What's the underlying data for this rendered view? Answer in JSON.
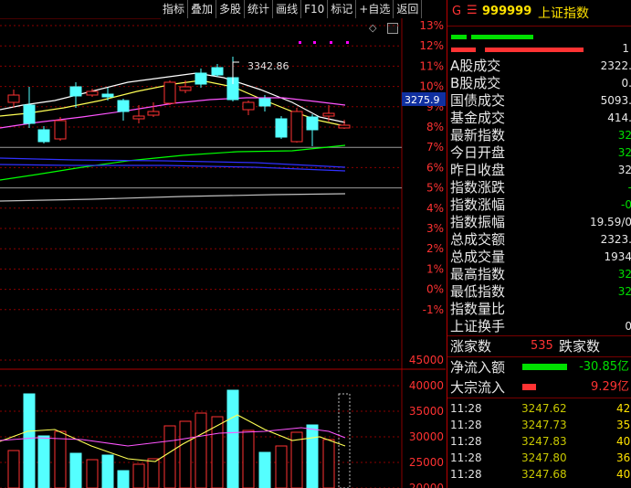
{
  "toolbar": {
    "buttons": [
      "指标",
      "叠加",
      "多股",
      "统计",
      "画线",
      "F10",
      "标记",
      "+自选",
      "返回"
    ]
  },
  "header": {
    "g_label": "G",
    "menu_icon_glyph": "☰",
    "code": "999999",
    "name": "上证指数"
  },
  "main_chart": {
    "price_scale_labels": [
      "13%",
      "12%",
      "11%",
      "10%",
      "9%",
      "8%",
      "7%",
      "6%",
      "5%",
      "4%",
      "3%",
      "2%",
      "1%",
      "0%",
      "-1%"
    ],
    "high_label": "3342.86",
    "current_price_tag": "3275.9"
  },
  "volume_chart": {
    "scale_labels": [
      "45000",
      "40000",
      "35000",
      "30000",
      "25000",
      "20000"
    ]
  },
  "quote": {
    "bar_value": "1",
    "rows": [
      {
        "label": "A股成交",
        "value": "2322.",
        "color": "#e8e8e8"
      },
      {
        "label": "B股成交",
        "value": "0.",
        "color": "#e8e8e8"
      },
      {
        "label": "国债成交",
        "value": "5093.",
        "color": "#e8e8e8"
      },
      {
        "label": "基金成交",
        "value": "414.",
        "color": "#e8e8e8"
      },
      {
        "label": "最新指数",
        "value": "32",
        "color": "#00e000"
      },
      {
        "label": "今日开盘",
        "value": "32",
        "color": "#00e000"
      },
      {
        "label": "昨日收盘",
        "value": "32",
        "color": "#e8e8e8"
      },
      {
        "label": "指数涨跌",
        "value": "-",
        "color": "#00e000"
      },
      {
        "label": "指数涨幅",
        "value": "-0",
        "color": "#00e000"
      },
      {
        "label": "指数振幅",
        "value": "19.59/0",
        "color": "#e8e8e8"
      },
      {
        "label": "总成交额",
        "value": "2323.",
        "color": "#e8e8e8"
      },
      {
        "label": "总成交量",
        "value": "1934",
        "color": "#e8e8e8"
      },
      {
        "label": "最高指数",
        "value": "32",
        "color": "#00e000"
      },
      {
        "label": "最低指数",
        "value": "32",
        "color": "#00e000"
      },
      {
        "label": "指数量比",
        "value": "",
        "color": "#e8e8e8"
      },
      {
        "label": "上证换手",
        "value": "0",
        "color": "#e8e8e8"
      }
    ]
  },
  "breadth": {
    "up_label": "涨家数",
    "up_value": "535",
    "down_label": "跌家数"
  },
  "flows": [
    {
      "label": "净流入额",
      "value": "-30.85亿",
      "color": "#00e000"
    },
    {
      "label": "大宗流入",
      "value": "9.29亿",
      "color": "#ff3333"
    }
  ],
  "ticks": [
    {
      "time": "11:28",
      "price": "3247.62",
      "vol": "42"
    },
    {
      "time": "11:28",
      "price": "3247.73",
      "vol": "35"
    },
    {
      "time": "11:28",
      "price": "3247.83",
      "vol": "40"
    },
    {
      "time": "11:28",
      "price": "3247.80",
      "vol": "36"
    },
    {
      "time": "11:28",
      "price": "3247.68",
      "vol": "40"
    }
  ],
  "colors": {
    "up": "#ff3232",
    "down": "#54ffff",
    "ma_white": "#ffffff",
    "ma_yellow": "#ffff54",
    "ma_magenta": "#ff54ff",
    "ma_green": "#00ff00",
    "ma_blue": "#3030ff",
    "ma_gray": "#c0c0c0",
    "grid": "#8b0000"
  }
}
